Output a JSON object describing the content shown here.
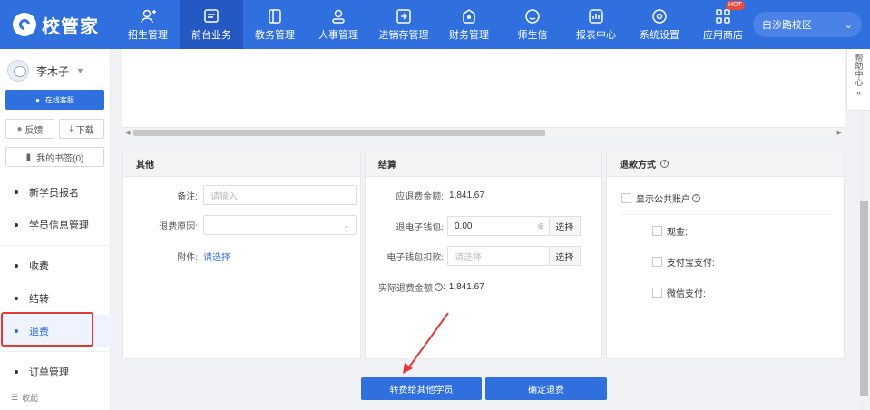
{
  "brand": {
    "name": "校管家"
  },
  "nav": [
    {
      "label": "招生管理",
      "icon": "person-add-icon"
    },
    {
      "label": "前台业务",
      "icon": "monitor-icon",
      "active": true
    },
    {
      "label": "教务管理",
      "icon": "book-icon"
    },
    {
      "label": "人事管理",
      "icon": "user-icon"
    },
    {
      "label": "进销存管理",
      "icon": "box-icon"
    },
    {
      "label": "财务管理",
      "icon": "money-icon"
    },
    {
      "label": "师生信",
      "icon": "chat-icon"
    },
    {
      "label": "报表中心",
      "icon": "chart-icon"
    },
    {
      "label": "系统设置",
      "icon": "gear-icon"
    },
    {
      "label": "应用商店",
      "icon": "apps-icon",
      "badge": "HOT"
    }
  ],
  "campus": {
    "value": "白沙路校区"
  },
  "sidebar": {
    "username": "李木子",
    "online_service": "在线客服",
    "feedback": "反馈",
    "download": "下载",
    "bookmarks": "我的书签(0)",
    "menu": [
      {
        "label": "新学员报名"
      },
      {
        "label": "学员信息管理"
      },
      {
        "label": "收费"
      },
      {
        "label": "结转"
      },
      {
        "label": "退费",
        "active": true
      },
      {
        "label": "订单管理"
      }
    ],
    "collapse": "收起"
  },
  "other": {
    "title": "其他",
    "remark_label": "备注:",
    "remark_placeholder": "请输入",
    "reason_label": "退费原因:",
    "attachment_label": "附件:",
    "attachment_link": "请选择"
  },
  "settlement": {
    "title": "结算",
    "due_label": "应退费金额:",
    "due_value": "1,841.67",
    "ewallet_label": "退电子钱包:",
    "ewallet_value": "0.00",
    "select_btn": "选择",
    "deduct_label": "电子钱包扣款:",
    "deduct_placeholder": "请选择",
    "actual_label": "实际退费金额",
    "actual_value": "1,841.67"
  },
  "refund_method": {
    "title": "退款方式",
    "public_account": "显示公共账户",
    "cash": "现金:",
    "alipay": "支付宝支付:",
    "wechat": "微信支付:"
  },
  "buttons": {
    "transfer": "转费给其他学员",
    "confirm": "确定退费"
  },
  "help": "帮助中心"
}
